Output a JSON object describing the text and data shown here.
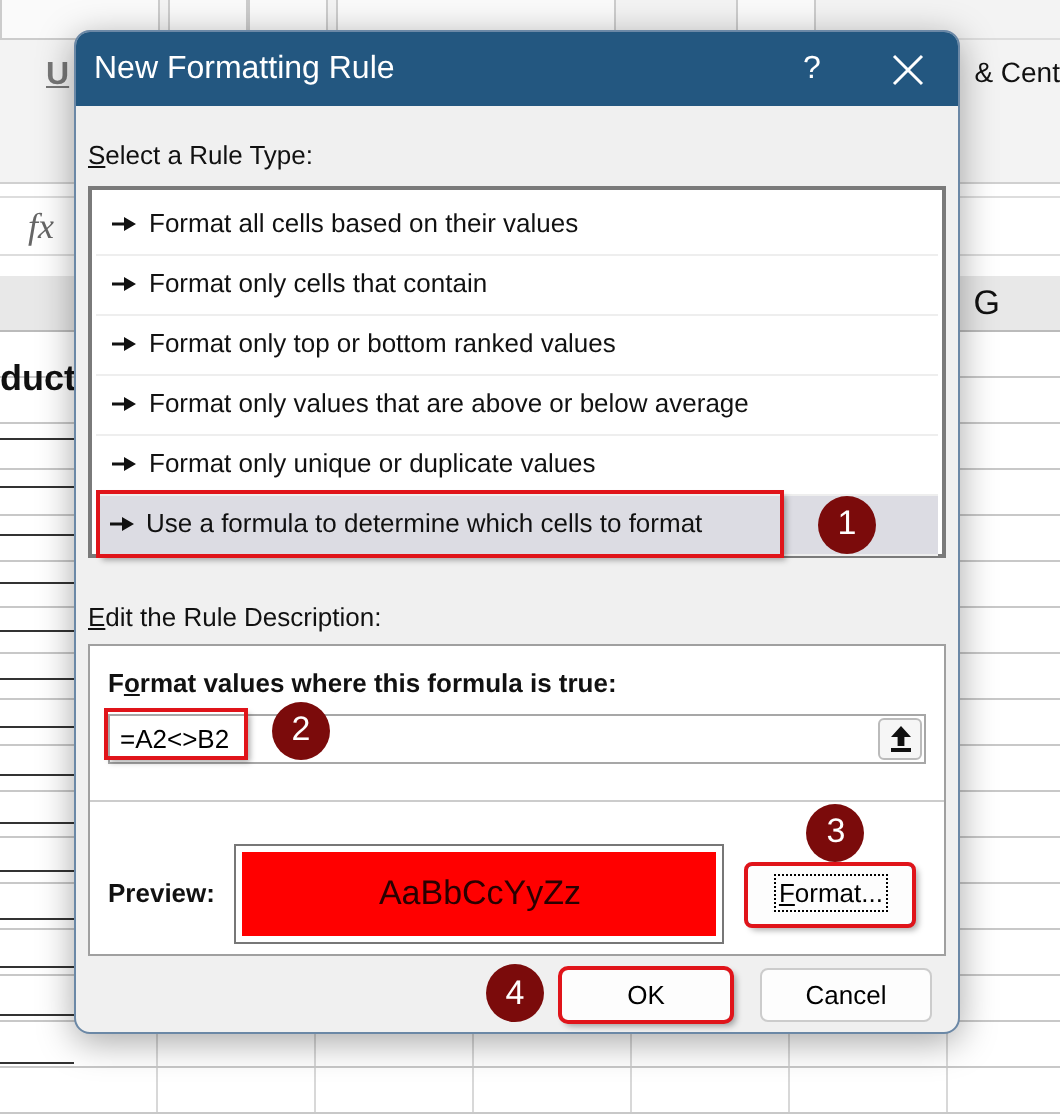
{
  "sheet": {
    "ribbon_underline": "U",
    "ribbon_merge": "& Cent",
    "formula_icon": "fx",
    "column_header": "G",
    "cell_text": "duct"
  },
  "window": {
    "title": "New Formatting Rule",
    "help": "?"
  },
  "rule_type_label": [
    {
      "text": "S",
      "underlined": true
    },
    {
      "text": "elect a Rule Type:",
      "underlined": false
    }
  ],
  "rule_types": [
    {
      "label": "Format all cells based on their values",
      "selected": false,
      "highlighted": false
    },
    {
      "label": "Format only cells that contain",
      "selected": false,
      "highlighted": false
    },
    {
      "label": "Format only top or bottom ranked values",
      "selected": false,
      "highlighted": false
    },
    {
      "label": "Format only values that are above or below average",
      "selected": false,
      "highlighted": false
    },
    {
      "label": "Format only unique or duplicate values",
      "selected": false,
      "highlighted": false
    },
    {
      "label": "Use a formula to determine which cells to format",
      "selected": true,
      "highlighted": true,
      "callout": "1"
    }
  ],
  "description_label": [
    {
      "text": "E",
      "underlined": true
    },
    {
      "text": "dit the Rule Description:",
      "underlined": false
    }
  ],
  "formula": {
    "label": [
      {
        "text": "F",
        "underlined": false
      },
      {
        "text": "o",
        "underlined": true
      },
      {
        "text": "rmat values where this formula is true:",
        "underlined": false
      }
    ],
    "value": "=A2<>B2",
    "highlighted": true,
    "callout": "2"
  },
  "preview": {
    "label": "Preview:",
    "sample": "AaBbCcYyZz"
  },
  "format_button": {
    "label": [
      {
        "text": "F",
        "underlined": true
      },
      {
        "text": "ormat...",
        "underlined": false
      }
    ],
    "highlighted": true,
    "focused": true,
    "callout": "3"
  },
  "buttons": [
    {
      "label": "OK",
      "highlighted": true,
      "callout": "4"
    },
    {
      "label": "Cancel",
      "highlighted": false
    }
  ]
}
